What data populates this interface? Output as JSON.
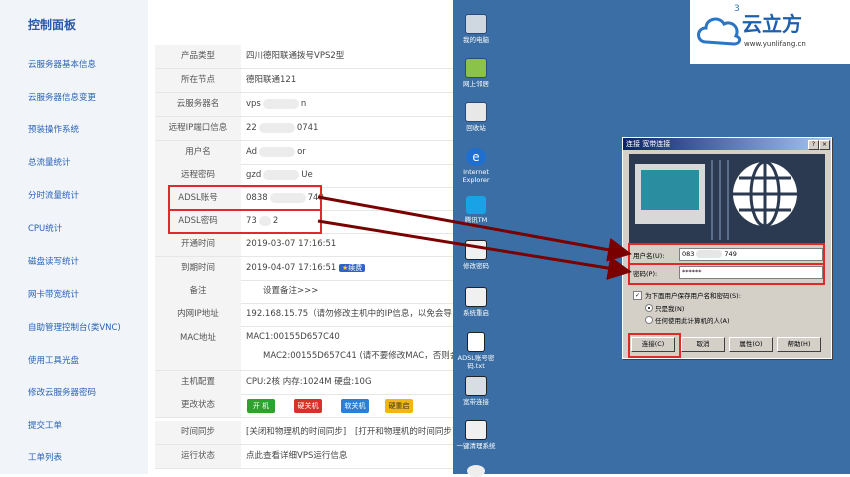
{
  "sidebar": {
    "title": "控制面板",
    "items": [
      {
        "label": "云服务器基本信息"
      },
      {
        "label": "云服务器信息变更"
      },
      {
        "label": "预装操作系统"
      },
      {
        "label": "总流量统计"
      },
      {
        "label": "分时流量统计"
      },
      {
        "label": "CPU统计"
      },
      {
        "label": "磁盘读写统计"
      },
      {
        "label": "网卡带宽统计"
      },
      {
        "label": "自助管理控制台(类VNC)"
      },
      {
        "label": "使用工具光盘"
      },
      {
        "label": "修改云服务器密码"
      },
      {
        "label": "提交工单"
      },
      {
        "label": "工单列表"
      }
    ]
  },
  "info": {
    "product_type": {
      "label": "产品类型",
      "value": "四川德阳联通拨号VPS2型"
    },
    "node": {
      "label": "所在节点",
      "value": "德阳联通121"
    },
    "server_name": {
      "label": "云服务器名",
      "value_a": "vps",
      "value_b": "n"
    },
    "remote_ip": {
      "label": "远程IP端口信息",
      "value_a": "22",
      "value_b": "0741"
    },
    "username": {
      "label": "用户名",
      "value_a": "Ad",
      "value_b": "or"
    },
    "remote_pwd": {
      "label": "远程密码",
      "value_a": "gzd",
      "value_b": "Ue"
    },
    "adsl_account": {
      "label": "ADSL账号",
      "value_a": "0838",
      "value_b": "749"
    },
    "adsl_pwd": {
      "label": "ADSL密码",
      "value_a": "73",
      "value_b": "2"
    },
    "open_time": {
      "label": "开通时间",
      "value": "2019-03-07 17:16:51"
    },
    "expire_time": {
      "label": "到期时间",
      "value": "2019-04-07 17:16:51",
      "renew": "续费"
    },
    "remark": {
      "label": "备注",
      "value": "设置备注>>>"
    },
    "intranet_ip": {
      "label": "内网IP地址",
      "value": "192.168.15.75（请勿修改主机中的IP信息，以免会导致无"
    },
    "mac": {
      "label": "MAC地址",
      "value1": "MAC1:00155D657C40",
      "value2": "MAC2:00155D657C41 (请不要修改MAC，否则会"
    },
    "host_config": {
      "label": "主机配置",
      "value": "CPU:2核 内存:1024M 硬盘:10G"
    },
    "change_state": {
      "label": "更改状态",
      "buttons": [
        "开 机",
        "硬关机",
        "软关机",
        "硬重启"
      ]
    },
    "time_sync": {
      "label": "时间同步",
      "link1": "[关闭和物理机的时间同步]",
      "link2": "[打开和物理机的时间同步]"
    },
    "run_state": {
      "label": "运行状态",
      "value": "点此查看详细VPS运行信息"
    }
  },
  "logo": {
    "brand": "云立方",
    "superscript": "3",
    "url": "www.yunlifang.cn"
  },
  "desktop_icons": [
    {
      "label": "我的电脑",
      "icon": "computer-icon"
    },
    {
      "label": "网上邻居",
      "icon": "network-icon"
    },
    {
      "label": "回收站",
      "icon": "recycle-bin-icon"
    },
    {
      "label": "Internet Explorer",
      "icon": "ie-icon"
    },
    {
      "label": "腾讯TM",
      "icon": "tm-icon"
    },
    {
      "label": "修改密码",
      "icon": "password-icon"
    },
    {
      "label": "系统重启",
      "icon": "restart-icon"
    },
    {
      "label": "ADSL账号密码.txt",
      "icon": "text-file-icon"
    },
    {
      "label": "宽带连接",
      "icon": "broadband-icon"
    },
    {
      "label": "一键清理系统",
      "icon": "cleanup-icon"
    }
  ],
  "dialog": {
    "title": "连接 宽带连接",
    "help_btn": "?",
    "close_btn": "×",
    "username_label": "用户名(U):",
    "username_value_a": "083",
    "username_value_b": "749",
    "password_label": "密码(P):",
    "password_value": "******",
    "save_label": "为下面用户保存用户名和密码(S):",
    "only_me": "只是我(N)",
    "anyone": "任何使用此计算机的人(A)",
    "connect": "连接(C)",
    "cancel": "取消",
    "properties": "属性(O)",
    "help": "帮助(H)"
  },
  "colors": {
    "accent_red": "#e02a2a",
    "arrow": "#7a0000",
    "desktop": "#3b6ea5",
    "link": "#2f63c2"
  }
}
